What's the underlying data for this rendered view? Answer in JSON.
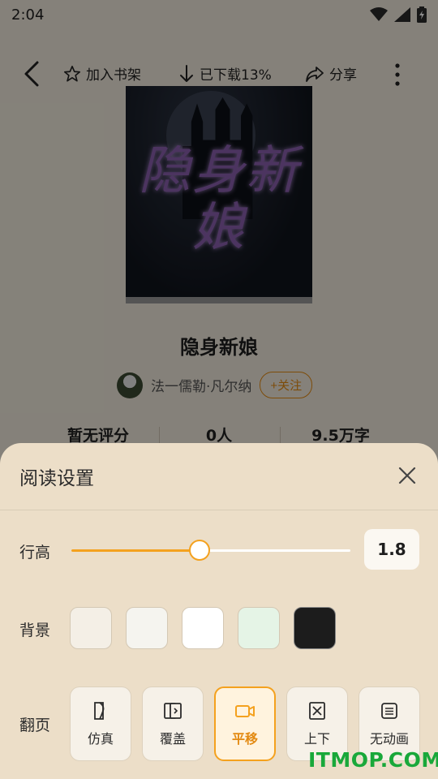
{
  "status": {
    "time": "2:04"
  },
  "topbar": {
    "add_shelf": "加入书架",
    "downloaded": "已下载13%",
    "share": "分享"
  },
  "book": {
    "cover_title": "隐身新娘",
    "title": "隐身新娘",
    "author": "法一儒勒·凡尔纳",
    "follow": "+关注",
    "stats": [
      "暂无评分",
      "0人",
      "9.5万字"
    ]
  },
  "settings": {
    "title": "阅读设置",
    "line_height_label": "行高",
    "line_height_value": "1.8",
    "line_height_slider_fraction": 0.46,
    "background_label": "背景",
    "background_colors": [
      "#f4efe6",
      "#f5f4ef",
      "#ffffff",
      "#e5f4e6",
      "#1c1c1c"
    ],
    "page_flip_label": "翻页",
    "page_flip_options": [
      "仿真",
      "覆盖",
      "平移",
      "上下",
      "无动画"
    ],
    "page_flip_selected": "平移",
    "accent_color": "#f4a11e"
  },
  "watermark": "ITMOP.COM"
}
